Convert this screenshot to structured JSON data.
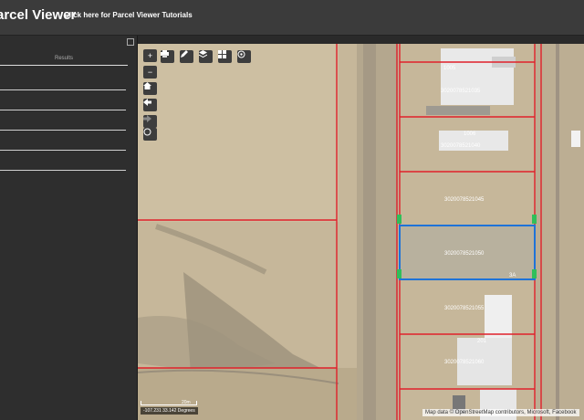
{
  "header": {
    "title": "Parcel Viewer",
    "tutorial_link": "Click here for Parcel Viewer Tutorials"
  },
  "sidebar": {
    "results_tab": "Results"
  },
  "map": {
    "parcels": [
      {
        "id": "3020078521035",
        "number": "1005"
      },
      {
        "id": "3020078521040",
        "number": "1006"
      },
      {
        "id": "3020078521045",
        "number": ""
      },
      {
        "id": "3020078521050",
        "number": "3A",
        "selected": true
      },
      {
        "id": "3020078521055",
        "number": ""
      },
      {
        "id": "3020078521060",
        "number": "201"
      }
    ],
    "coordinates": "-107.231 33.142 Degrees",
    "scale_label": "20m",
    "attribution": "Map data © OpenStreetMap contributors, Microsoft, Facebook",
    "colors": {
      "parcel_line": "#e0202a",
      "selected": "#1e73d8",
      "marker": "#2fbf5a"
    },
    "tools": [
      "zoom-in",
      "zoom-out",
      "home",
      "back",
      "forward",
      "locate",
      "print",
      "draw",
      "layers",
      "basemap",
      "measure"
    ]
  }
}
